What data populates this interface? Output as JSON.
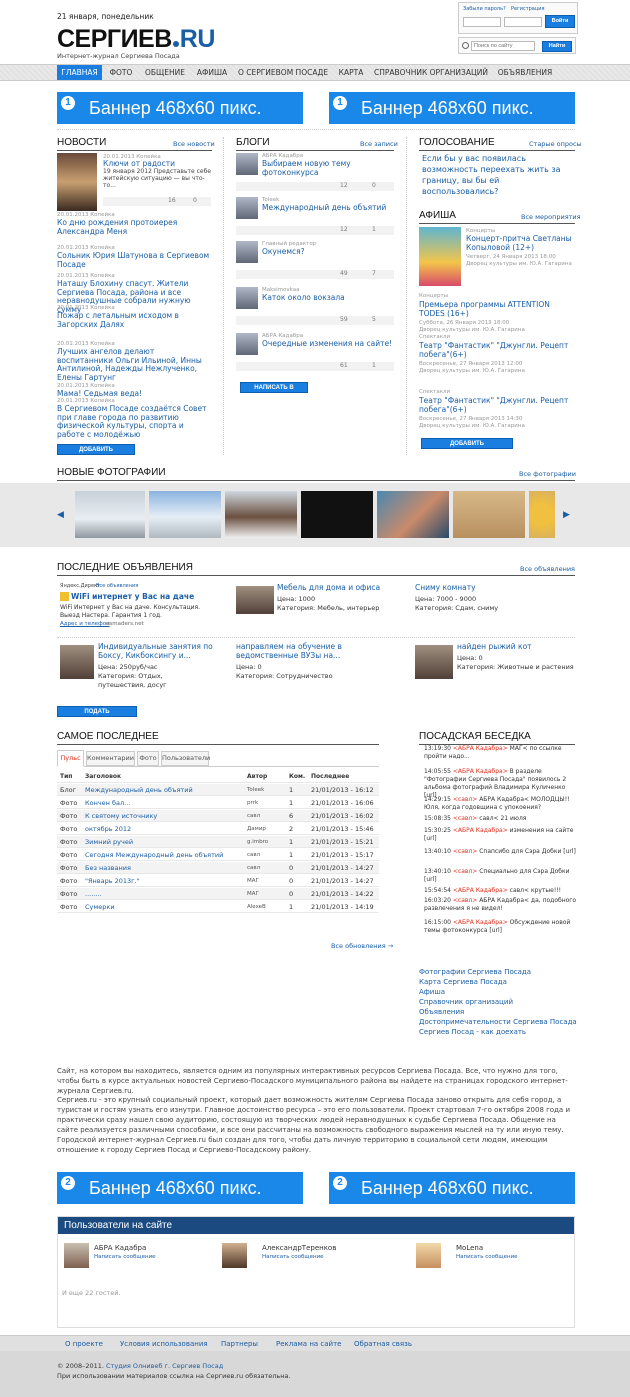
{
  "header": {
    "date": "21 января, понедельник",
    "logo_main": "СЕРГИЕВ",
    "logo_ru": "RU",
    "tagline": "Интернет-журнал Сергиева Посада",
    "forgot": "Забыли пароль?",
    "register": "Регистрация",
    "login_btn": "Войти",
    "search_placeholder": "Поиск по сайту",
    "search_btn": "Найти"
  },
  "nav": [
    "ГЛАВНАЯ",
    "ФОТО",
    "ОБЩЕНИЕ",
    "АФИША",
    "О СЕРГИЕВОМ ПОСАДЕ",
    "КАРТА",
    "СПРАВОЧНИК ОРГАНИЗАЦИЙ",
    "ОБЪЯВЛЕНИЯ"
  ],
  "banner_text": "Баннер 468x60 пикс.",
  "banner_num_top": "1",
  "banner_num_bottom": "2",
  "news": {
    "title": "НОВОСТИ",
    "all": "Все новости",
    "lead_meta": "20.01.2013 Копейка",
    "lead_title": "Ключи от радости",
    "lead_desc": "19 января 2012 Представьте себе житейскую ситуацию — вы что-то...",
    "lead_views": "16",
    "lead_comments": "0",
    "items": [
      {
        "meta": "20.01.2013 Копейка",
        "title": "Ко дню рождения протоиерея Александра Меня"
      },
      {
        "meta": "20.01.2013 Копейка",
        "title": "Сольник Юрия Шатунова в Сергиевом Посаде"
      },
      {
        "meta": "20.01.2013 Копейка",
        "title": "Наташу Блохину спасут. Жители Сергиева Посада, района и все неравнодушные собрали нужную сумму"
      },
      {
        "meta": "20.01.2013 Копейка",
        "title": "Пожар с летальным исходом в Загорских Далях"
      },
      {
        "meta": "20.01.2013 Копейка",
        "title": "Лучших ангелов делают воспитанники Ольги Ильиной, Инны Антилиной, Надежды Нежлученко, Елены Гартунг"
      },
      {
        "meta": "20.01.2013 Копейка",
        "title": "Мама! Седьмая веда!"
      },
      {
        "meta": "20.01.2013 Копейка",
        "title": "В Сергиевом Посаде создаётся Совет при главе города по развитию физической культуры, спорта и работе с молодёжью"
      }
    ],
    "add": "ДОБАВИТЬ НОВОСТЬ"
  },
  "blogs": {
    "title": "БЛОГИ",
    "all": "Все записи",
    "items": [
      {
        "author": "АБРА Кадабра",
        "title": "Выбираем новую тему фотоконкурса",
        "views": "12",
        "comments": "0"
      },
      {
        "author": "Toleek",
        "title": "Международный день объятий",
        "views": "12",
        "comments": "1"
      },
      {
        "author": "Главный редактор",
        "title": "Окунемся?",
        "views": "49",
        "comments": "7"
      },
      {
        "author": "Maksimovkaa",
        "title": "Каток около вокзала",
        "views": "59",
        "comments": "5"
      },
      {
        "author": "АБРА Кадабра",
        "title": "Очередные изменения на сайте!",
        "views": "61",
        "comments": "1"
      }
    ],
    "add": "НАПИСАТЬ В БЛОГ"
  },
  "poll": {
    "title": "ГОЛОСОВАНИЕ",
    "old": "Старые опросы",
    "question": "Если бы у вас появилась возможность переехать жить за границу, вы бы ей воспользовались?"
  },
  "afisha": {
    "title": "АФИША",
    "all": "Все мероприятия",
    "lead_cat": "Концерты",
    "lead_title": "Концерт-притча Светланы Копыловой (12+)",
    "lead_date": "Четверг, 24 Января 2013 18:00",
    "lead_place": "Дворец культуры им. Ю.А. Гагарина",
    "items": [
      {
        "cat": "Концерты",
        "title": "Премьера программы ATTENTION TODES (16+)",
        "date": "Суббота, 26 Января 2013 18:00",
        "place": "Дворец культуры им. Ю.А. Гагарина"
      },
      {
        "cat": "Спектакли",
        "title": "Театр \"Фантастик\" \"Джунгли. Рецепт побега\"(6+)",
        "date": "Воскресенье, 27 Января 2013 12:00",
        "place": "Дворец культуры им. Ю.А. Гагарина"
      },
      {
        "cat": "Спектакли",
        "title": "Театр \"Фантастик\" \"Джунгли. Рецепт побега\"(6+)",
        "date": "Воскресенье, 27 Января 2013 14:30",
        "place": "Дворец культуры им. Ю.А. Гагарина"
      }
    ],
    "add": "ДОБАВИТЬ МЕРОПРИЯТИЕ"
  },
  "photos": {
    "title": "НОВЫЕ ФОТОГРАФИИ",
    "all": "Все фотографии"
  },
  "ads": {
    "title": "ПОСЛЕДНИЕ ОБЪЯВЛЕНИЯ",
    "all": "Все объявления",
    "direct_label": "Яндекс.Директ",
    "direct_all": "Все объявления",
    "direct_title": "WiFi интернет у Вас на даче",
    "direct_desc": "WiFi Интернет у Вас на даче. Консультация. Выезд Настера. Гарантия 1 год.",
    "direct_links": "Адрес и телефон",
    "direct_site": "osmaders.net",
    "items": [
      {
        "title": "Мебель для дома и офиса",
        "price": "Цена: 1000",
        "cat": "Категория: Мебель, интерьер"
      },
      {
        "title": "Сниму комнату",
        "price": "Цена: 7000 - 9000",
        "cat": "Категория: Сдам, сниму"
      },
      {
        "title": "Индивидуальные занятия по Боксу, Кикбоксингу и...",
        "price": "Цена: 250руб/час",
        "cat": "Категория: Отдых, путешествия, досуг"
      },
      {
        "title": "направляем на обучение в ведомственные ВУЗы на...",
        "price": "Цена: 0",
        "cat": "Категория: Сотрудничество"
      },
      {
        "title": "найден рыжий кот",
        "price": "Цена: 0",
        "cat": "Категория: Животные и растения"
      }
    ],
    "add": "ПОДАТЬ ОБЪЯВЛЕНИЕ"
  },
  "recent": {
    "title": "САМОЕ ПОСЛЕДНЕЕ",
    "tabs": [
      "Пульс",
      "Комментарии",
      "Фото",
      "Пользователи"
    ],
    "cols": [
      "Тип",
      "Заголовок",
      "Автор",
      "Ком.",
      "Последнее"
    ],
    "rows": [
      [
        "Блог",
        "Международный день объятий",
        "Toleek",
        "1",
        "21/01/2013 - 16:12"
      ],
      [
        "Фото",
        "Кончен бал...",
        "prrk",
        "1",
        "21/01/2013 - 16:06"
      ],
      [
        "Фото",
        "К святому источнику",
        "савл",
        "6",
        "21/01/2013 - 16:02"
      ],
      [
        "Фото",
        "октябрь 2012",
        "Дамир",
        "2",
        "21/01/2013 - 15:46"
      ],
      [
        "Фото",
        "Зимний ручей",
        "g.imbro",
        "1",
        "21/01/2013 - 15:21"
      ],
      [
        "Фото",
        "Сегодня Международный день объятий",
        "савл",
        "1",
        "21/01/2013 - 15:17"
      ],
      [
        "Фото",
        "Без названия",
        "савл",
        "0",
        "21/01/2013 - 14:27"
      ],
      [
        "Фото",
        "\"Январь 2013г.\"",
        "МАГ",
        "0",
        "21/01/2013 - 14:27"
      ],
      [
        "Фото",
        "........",
        "МАГ",
        "0",
        "21/01/2013 - 14:22"
      ],
      [
        "Фото",
        "Сумерки",
        "AlexeB",
        "1",
        "21/01/2013 - 14:19"
      ]
    ],
    "all": "Все обновления →"
  },
  "chat": {
    "title": "ПОСАДСКАЯ БЕСЕДКА",
    "lines": [
      {
        "t": "13:19:30",
        "u": "<АБРА Кадабра>",
        "m": "МАГ< по ссылке пройти надо..."
      },
      {
        "t": "14:05:55",
        "u": "<АБРА Кадабра>",
        "m": "В разделе \"Фотографии Сергиева Посада\" появилось 2 альбома фотографий Владимира Куличенко [url]"
      },
      {
        "t": "14:29:15",
        "u": "<савл>",
        "m": "АБРА Кадабра< МОЛОДЦЫ!! Юля, когда годовщина с упокоения?"
      },
      {
        "t": "15:08:35",
        "u": "<савл>",
        "m": "савл< 21 июля"
      },
      {
        "t": "15:30:25",
        "u": "<АБРА Кадабра>",
        "m": "изменения на сайте [url]"
      },
      {
        "t": "13:40:10",
        "u": "<савл>",
        "m": "Спапсибо для Сэра Добки [url]"
      },
      {
        "t": "13:40:10",
        "u": "<савл>",
        "m": "Специально для Сэра Добки [url]"
      },
      {
        "t": "15:54:54",
        "u": "<АБРА Кадабра>",
        "m": "савл< крутые!!!"
      },
      {
        "t": "16:03:20",
        "u": "<савл>",
        "m": "АБРА Кадабра< да, подобного развлечения я не видел!"
      },
      {
        "t": "16:15:00",
        "u": "<АБРА Кадабра>",
        "m": "Обсуждение новой темы фотоконкурса [url]"
      }
    ]
  },
  "sidelinks": [
    "Фотографии Сергиева Посада",
    "Карта Сергиева Посада",
    "Афиша",
    "Справочник организаций",
    "Объявления",
    "Достопримечательности Сергиева Посада",
    "Сергиев Посад - как доехать"
  ],
  "about": {
    "p1": "Сайт, на котором вы находитесь, является одним из популярных интерактивных ресурсов Сергиева Посада. Все, что нужно для того, чтобы быть в курсе актуальных новостей Сергиево-Посадского муниципального района вы найдете на страницах городского интернет-журнала Сергиев.ru.",
    "p2": "Сергиев.ru - это крупный социальный проект, который дает возможность жителям Сергиева Посада заново открыть для себя город, а туристам и гостям узнать его изнутри. Главное достоинство ресурса – это его пользователи. Проект стартовал 7-го октября 2008 года и практически сразу нашел свою аудиторию, состоящую из творческих людей неравнодушных к судьбе Сергиева Посада. Общение на сайте реализуется различными способами, и все они рассчитаны на возможность свободного выражения мыслей на ту или иную тему. Городской интернет-журнал Сергиев.ru был создан для того, чтобы дать личную территорию в социальной сети людям, имеющим отношение к городу Сергиев Посад и Сергиево-Посадскому району."
  },
  "online": {
    "title": "Пользователи на сайте",
    "users": [
      {
        "name": "АБРА Кадабра",
        "msg": "Написать сообщение"
      },
      {
        "name": "АлександрТеренков",
        "msg": "Написать сообщение"
      },
      {
        "name": "MoLena",
        "msg": "Написать сообщение"
      }
    ],
    "guests": "И еще 22 гостей."
  },
  "footer": {
    "links": [
      "О проекте",
      "Условия использования",
      "Партнеры",
      "Реклама на сайте",
      "Обратная связь"
    ],
    "copy1": "© 2008–2011.",
    "copy_link": "Студия Олнивеб г. Сергиев Посад",
    "copy2": "При использовании материалов ссылка на Сергиев.ru обязательна."
  }
}
